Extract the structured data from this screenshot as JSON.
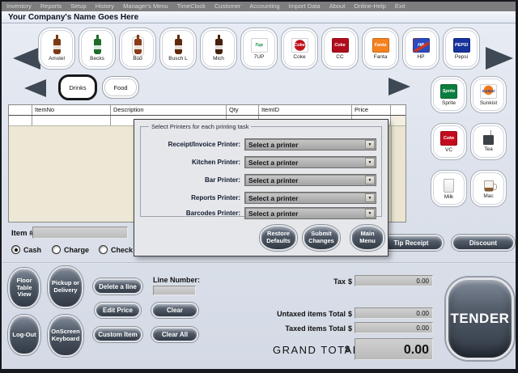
{
  "menu": {
    "items": [
      "Inventory",
      "Reports",
      "Setup",
      "History",
      "Manager's Menu",
      "TimeClock",
      "Customer",
      "Accounting",
      "Import Data",
      "About",
      "Online-Help",
      "Exit"
    ]
  },
  "header": {
    "company": "Your Company's Name Goes Here"
  },
  "products": {
    "items": [
      {
        "label": "Amstel",
        "icon": "beer-bottle",
        "color": "#7a3a12"
      },
      {
        "label": "Becks",
        "icon": "beer-bottle",
        "color": "#1f6b2a"
      },
      {
        "label": "Bud",
        "icon": "beer-bottle",
        "color": "#8a3c1a"
      },
      {
        "label": "Busch L",
        "icon": "beer-bottle",
        "color": "#5f2a0c"
      },
      {
        "label": "Mich",
        "icon": "beer-bottle",
        "color": "#45200a"
      },
      {
        "label": "7UP",
        "icon": "logo-tile",
        "logo_text": "7up",
        "color": "#ffffff",
        "text_color": "#0a8a3c"
      },
      {
        "label": "Coke",
        "icon": "logo-disc",
        "logo_text": "Coke",
        "color": "#c0121c",
        "text_color": "#ffffff"
      },
      {
        "label": "CC",
        "icon": "logo-tile",
        "logo_text": "Coke",
        "color": "#b00d1c",
        "text_color": "#ffffff"
      },
      {
        "label": "Fanta",
        "icon": "logo-tile",
        "logo_text": "Fanta",
        "color": "#f5821f",
        "text_color": "#ffffff"
      },
      {
        "label": "HP",
        "icon": "logo-tile",
        "logo_text": "HP",
        "color": "#2b4bbf",
        "text_color": "#ffffff"
      },
      {
        "label": "Pepsi",
        "icon": "logo-tile",
        "logo_text": "PEPSI",
        "color": "#16339c",
        "text_color": "#ffffff"
      }
    ]
  },
  "side_products": {
    "items": [
      {
        "label": "Sprite",
        "icon": "logo-tile",
        "logo_text": "Sprite",
        "color": "#0b7d3e",
        "text_color": "#ffffff"
      },
      {
        "label": "Sunkist",
        "icon": "logo-tile",
        "logo_text": "Sunkist",
        "color": "#f07818",
        "text_color": "#1a3fa8"
      },
      {
        "label": "VC",
        "icon": "logo-tile",
        "logo_text": "Coke",
        "color": "#c40b1e",
        "text_color": "#ffffff"
      },
      {
        "label": "Tea",
        "icon": "teabag"
      },
      {
        "label": "Milk",
        "icon": "milk-glass"
      },
      {
        "label": "Mac",
        "icon": "coffee-mug"
      }
    ]
  },
  "categories": {
    "items": [
      {
        "label": "Drinks",
        "selected": true
      },
      {
        "label": "Food",
        "selected": false
      }
    ]
  },
  "table": {
    "columns": [
      "",
      "ItemNo",
      "Description",
      "Qty",
      "ItemID",
      "Price"
    ]
  },
  "dialog": {
    "title": "Select Printers for each printing task",
    "fields": [
      {
        "label": "Receipt/Invoice Printer:",
        "value": "Select a printer"
      },
      {
        "label": "Kitchen Printer:",
        "value": "Select a printer"
      },
      {
        "label": "Bar Printer:",
        "value": "Select a printer"
      },
      {
        "label": "Reports Printer:",
        "value": "Select a printer"
      },
      {
        "label": "Barcodes Printer:",
        "value": "Select a printer"
      }
    ],
    "buttons": [
      {
        "label": "Restore Defaults"
      },
      {
        "label": "Submit Changes"
      },
      {
        "label": "Main Menu"
      }
    ]
  },
  "item_entry": {
    "label": "Item #",
    "value": ""
  },
  "payment": {
    "options": [
      {
        "label": "Cash",
        "selected": true
      },
      {
        "label": "Charge",
        "selected": false
      },
      {
        "label": "Check",
        "selected": false
      }
    ]
  },
  "left_buttons": {
    "floor": "Floor Table View",
    "pickup": "Pickup or Delivery",
    "logout": "Log-Out",
    "keyboard": "OnScreen Keyboard"
  },
  "mid_buttons": {
    "delete_line": "Delete a line",
    "edit_price": "Edit Price",
    "custom_item": "Custom Item",
    "clear": "Clear",
    "clear_all": "Clear All",
    "line_number_label": "Line Number:",
    "line_number_value": ""
  },
  "totals": {
    "currency": "$",
    "tax_label": "Tax",
    "tax_value": "0.00",
    "untaxed_label": "Untaxed items Total",
    "untaxed_value": "0.00",
    "taxed_label": "Taxed items Total",
    "taxed_value": "0.00",
    "grand_label": "GRAND TOTAL",
    "grand_value": "0.00",
    "tender_label": "TENDER",
    "tip_label": "Tip Receipt",
    "discount_label": "Discount"
  }
}
